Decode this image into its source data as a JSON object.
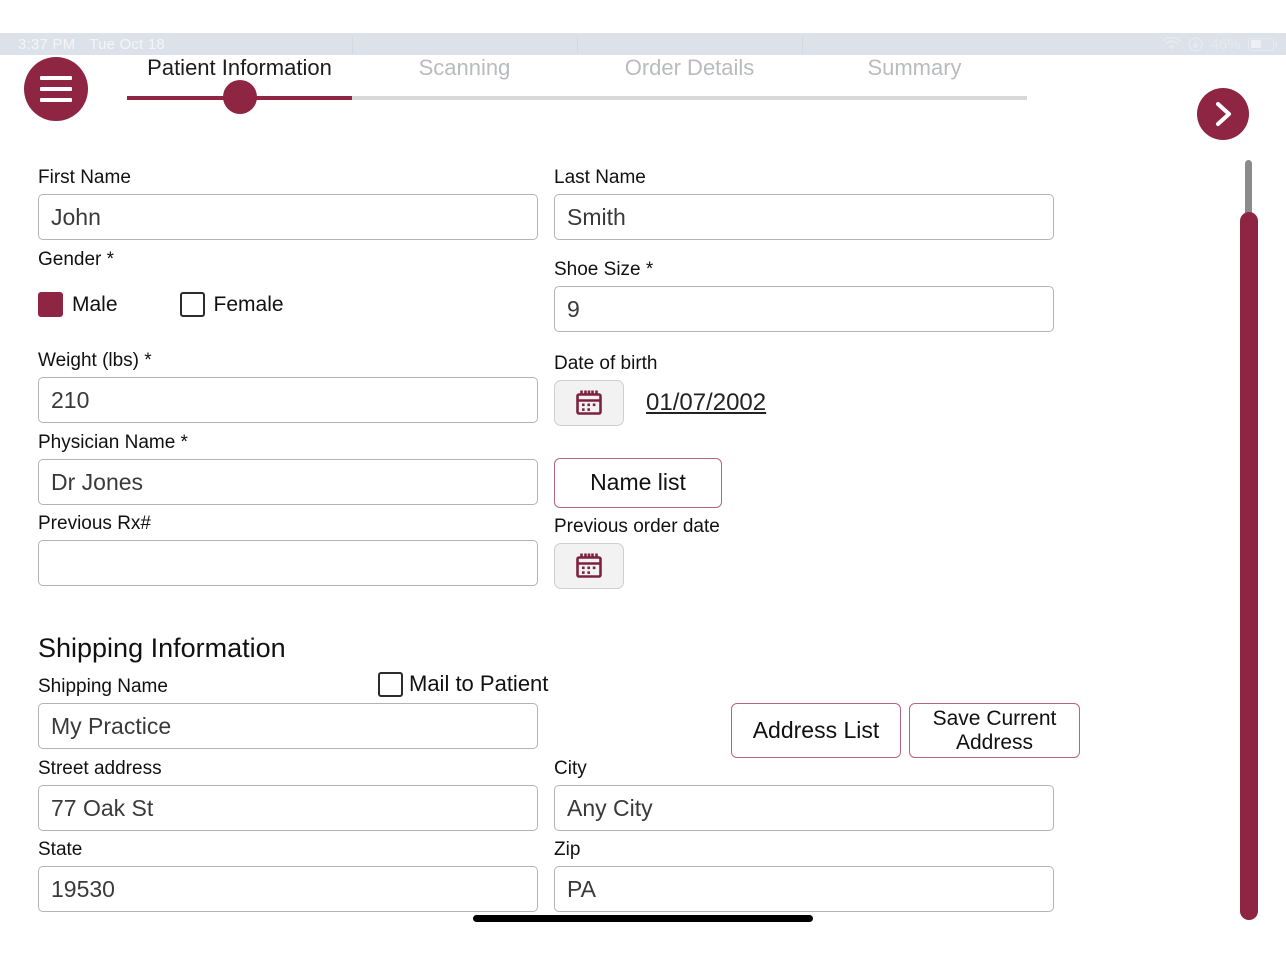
{
  "status_bar": {
    "time": "3:37 PM",
    "date": "Tue Oct 18",
    "battery_percent": "46%",
    "wifi_icon": "wifi-icon",
    "rotation_lock_icon": "rotation-lock-icon",
    "battery_icon": "battery-icon"
  },
  "header": {
    "menu_icon": "hamburger-menu-icon",
    "next_icon": "chevron-right-icon",
    "tabs": [
      {
        "label": "Patient Information",
        "active": true
      },
      {
        "label": "Scanning",
        "active": false
      },
      {
        "label": "Order Details",
        "active": false
      },
      {
        "label": "Summary",
        "active": false
      }
    ]
  },
  "patient": {
    "first_name_label": "First Name",
    "first_name_value": "John",
    "last_name_label": "Last Name",
    "last_name_value": "Smith",
    "gender_label": "Gender *",
    "gender_male_label": "Male",
    "gender_female_label": "Female",
    "gender_male_checked": true,
    "gender_female_checked": false,
    "shoe_size_label": "Shoe Size *",
    "shoe_size_value": "9",
    "weight_label": "Weight (lbs) *",
    "weight_value": "210",
    "dob_label": "Date of birth",
    "dob_value": "01/07/2002",
    "dob_calendar_icon": "calendar-icon",
    "physician_label": "Physician Name *",
    "physician_value": "Dr Jones",
    "name_list_label": "Name list",
    "previous_rx_label": "Previous Rx#",
    "previous_rx_value": "",
    "previous_rx_placeholder": "",
    "previous_order_date_label": "Previous order date",
    "previous_order_calendar_icon": "calendar-icon"
  },
  "shipping": {
    "section_title": "Shipping Information",
    "shipping_name_label": "Shipping Name",
    "shipping_name_value": "My Practice",
    "mail_to_patient_label": "Mail to Patient",
    "mail_to_patient_checked": false,
    "address_list_label": "Address List",
    "save_current_address_label": "Save Current Address",
    "street_label": "Street address",
    "street_value": "77 Oak St",
    "city_label": "City",
    "city_value": "Any City",
    "state_label": "State",
    "state_value": "19530",
    "zip_label": "Zip",
    "zip_value": "PA"
  },
  "colors": {
    "brand_maroon": "#8e2543",
    "outline_pink": "#b9647f",
    "field_border": "#b4b4b4",
    "inactive_tab": "#b9bbbf",
    "statusbar_bg": "#dde1ea"
  }
}
